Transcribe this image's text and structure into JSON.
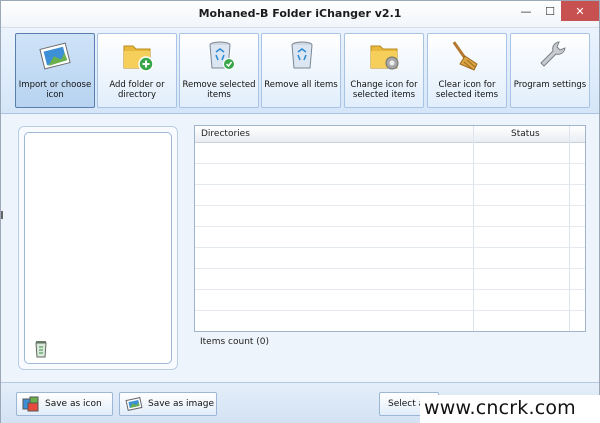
{
  "window": {
    "title": "Mohaned-B Folder iChanger v2.1",
    "controls": {
      "minimize": "—",
      "maximize": "☐",
      "close": "✕"
    }
  },
  "toolbar": {
    "buttons": [
      {
        "label": "Import or choose icon",
        "icon": "image-icon",
        "active": true
      },
      {
        "label": "Add folder or directory",
        "icon": "folder-add-icon"
      },
      {
        "label": "Remove selected items",
        "icon": "recycle-bin-check-icon"
      },
      {
        "label": "Remove all items",
        "icon": "recycle-bin-icon"
      },
      {
        "label": "Change icon for selected items",
        "icon": "folder-gear-icon"
      },
      {
        "label": "Clear icon for selected items",
        "icon": "broom-icon"
      },
      {
        "label": "Program settings",
        "icon": "wrench-icon"
      }
    ]
  },
  "table": {
    "columns": [
      "Directories",
      "Status"
    ],
    "rows": []
  },
  "items_count": "Items count (0)",
  "bottom": {
    "save_icon": "Save as icon",
    "save_image": "Save as image",
    "select_all": "Select al"
  },
  "watermark": "www.cncrk.com",
  "colors": {
    "accent": "#5a7fae",
    "close_button": "#c75050",
    "toolbar_bg": "#d5e6f8"
  }
}
